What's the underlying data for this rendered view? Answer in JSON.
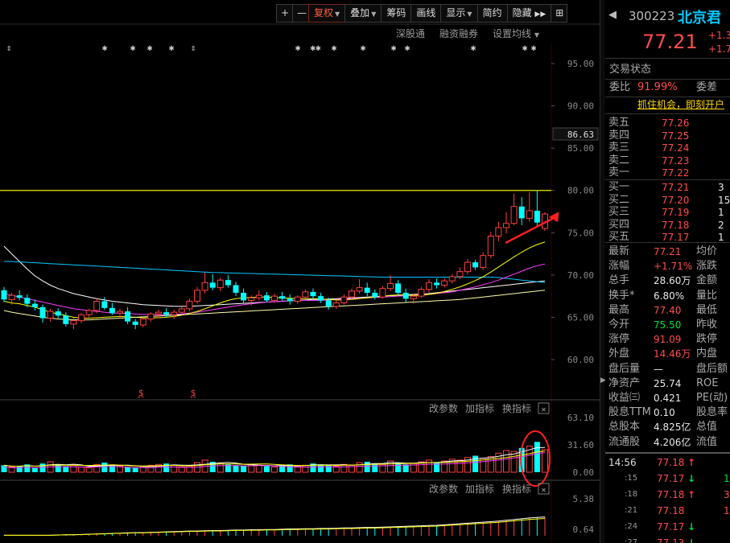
{
  "toolbar": {
    "plus": "+",
    "minus": "—",
    "rights": "复权",
    "overlay": "叠加",
    "chips": "筹码",
    "draw": "画线",
    "display": "显示",
    "simple": "简约",
    "hide": "隐藏",
    "scroll_glyph": "▶▶",
    "more_glyph": "⊞"
  },
  "subtabs": [
    "深股通",
    "融资融券",
    "设置均线"
  ],
  "chart_data": [
    {
      "type": "candlestick",
      "title": "",
      "ylim": [
        56,
        98
      ],
      "y_ticks": [
        "95.00",
        "90.00",
        "85.00",
        "80.00",
        "75.00",
        "70.00",
        "65.00",
        "60.00"
      ],
      "price_marker": "86.63",
      "resistance_line": 80.0,
      "event_markers": [
        "⇕",
        "✱",
        "✱",
        "✱",
        "✱",
        "⇕",
        "✱",
        "✱✱",
        "✱",
        "✱",
        "✱",
        "✱",
        "✱",
        "✱",
        "✱"
      ],
      "dividend_markers": [
        "$",
        "$"
      ],
      "candles": [
        [
          68.2,
          68.6,
          66.8,
          67.1
        ],
        [
          67.1,
          67.9,
          66.5,
          67.6
        ],
        [
          67.6,
          68.2,
          67.0,
          67.3
        ],
        [
          67.3,
          67.7,
          66.2,
          66.6
        ],
        [
          66.6,
          67.1,
          65.8,
          66.2
        ],
        [
          66.2,
          66.5,
          64.4,
          64.9
        ],
        [
          64.9,
          66.0,
          64.5,
          65.7
        ],
        [
          65.7,
          66.1,
          64.9,
          65.2
        ],
        [
          65.2,
          65.6,
          63.9,
          64.2
        ],
        [
          64.2,
          64.9,
          63.6,
          64.6
        ],
        [
          64.6,
          65.5,
          64.3,
          65.3
        ],
        [
          65.3,
          66.0,
          65.0,
          65.8
        ],
        [
          65.8,
          67.2,
          65.5,
          66.9
        ],
        [
          66.9,
          67.4,
          65.9,
          66.1
        ],
        [
          66.1,
          66.7,
          65.3,
          65.5
        ],
        [
          65.5,
          66.0,
          64.9,
          65.7
        ],
        [
          65.7,
          66.2,
          64.2,
          64.5
        ],
        [
          64.5,
          64.8,
          63.6,
          64.1
        ],
        [
          64.1,
          65.0,
          63.8,
          64.8
        ],
        [
          64.8,
          65.6,
          64.5,
          65.4
        ],
        [
          65.4,
          65.9,
          64.9,
          65.6
        ],
        [
          65.6,
          66.1,
          65.0,
          65.3
        ],
        [
          65.3,
          65.9,
          64.8,
          65.6
        ],
        [
          65.6,
          66.3,
          65.3,
          66.0
        ],
        [
          66.0,
          67.2,
          65.7,
          66.9
        ],
        [
          66.9,
          68.6,
          66.6,
          68.2
        ],
        [
          68.2,
          70.3,
          67.8,
          69.1
        ],
        [
          69.1,
          70.1,
          68.2,
          68.5
        ],
        [
          68.5,
          69.7,
          68.1,
          69.4
        ],
        [
          69.4,
          70.0,
          68.5,
          68.8
        ],
        [
          68.8,
          69.2,
          67.5,
          67.9
        ],
        [
          67.9,
          68.4,
          66.6,
          67.0
        ],
        [
          67.0,
          67.6,
          66.4,
          67.3
        ],
        [
          67.3,
          68.2,
          67.0,
          67.6
        ],
        [
          67.6,
          68.0,
          66.8,
          67.0
        ],
        [
          67.0,
          67.8,
          66.7,
          67.5
        ],
        [
          67.5,
          68.0,
          66.9,
          67.2
        ],
        [
          67.2,
          67.7,
          66.5,
          66.9
        ],
        [
          66.9,
          67.6,
          66.6,
          67.4
        ],
        [
          67.4,
          68.3,
          67.1,
          68.0
        ],
        [
          68.0,
          68.4,
          67.1,
          67.5
        ],
        [
          67.5,
          67.9,
          66.7,
          67.0
        ],
        [
          67.0,
          67.3,
          65.9,
          66.3
        ],
        [
          66.3,
          67.0,
          66.0,
          66.7
        ],
        [
          66.7,
          67.7,
          66.5,
          67.4
        ],
        [
          67.4,
          68.4,
          67.2,
          68.1
        ],
        [
          68.1,
          69.5,
          67.8,
          68.5
        ],
        [
          68.5,
          69.1,
          67.5,
          67.9
        ],
        [
          67.9,
          68.3,
          67.1,
          67.4
        ],
        [
          67.4,
          68.7,
          67.2,
          68.4
        ],
        [
          68.4,
          70.0,
          68.1,
          69.0
        ],
        [
          69.0,
          69.4,
          67.6,
          67.9
        ],
        [
          67.9,
          68.4,
          66.8,
          67.2
        ],
        [
          67.2,
          67.8,
          66.6,
          67.5
        ],
        [
          67.5,
          68.6,
          67.3,
          68.3
        ],
        [
          68.3,
          69.5,
          67.9,
          69.1
        ],
        [
          69.1,
          69.6,
          68.4,
          68.8
        ],
        [
          68.8,
          69.6,
          68.5,
          69.3
        ],
        [
          69.3,
          70.1,
          69.0,
          69.8
        ],
        [
          69.8,
          70.9,
          69.5,
          70.4
        ],
        [
          70.4,
          71.9,
          70.1,
          71.5
        ],
        [
          71.5,
          71.8,
          70.6,
          70.9
        ],
        [
          70.9,
          72.7,
          70.6,
          72.3
        ],
        [
          72.3,
          75.1,
          72.0,
          74.6
        ],
        [
          74.6,
          76.3,
          74.0,
          75.6
        ],
        [
          75.6,
          77.4,
          74.9,
          76.1
        ],
        [
          76.1,
          79.6,
          75.9,
          78.1
        ],
        [
          78.1,
          79.2,
          75.9,
          76.7
        ],
        [
          76.7,
          79.8,
          76.3,
          77.6
        ],
        [
          77.6,
          80.0,
          75.8,
          76.2
        ],
        [
          75.5,
          77.4,
          75.2,
          77.21
        ]
      ],
      "ma_series": [
        {
          "color": "#ffffff",
          "values": [
            73.4,
            72.5,
            71.6,
            70.7,
            69.9,
            69.3,
            68.8,
            68.4,
            68.1,
            67.8,
            67.6,
            67.4,
            67.2,
            67.05,
            66.9,
            66.8,
            66.7,
            66.6,
            66.5,
            66.45,
            66.4,
            66.35,
            66.3,
            66.3,
            66.3,
            66.35,
            66.4,
            66.45,
            66.5,
            66.55,
            66.6,
            66.65,
            66.7,
            66.75,
            66.8,
            66.85,
            66.9,
            66.95,
            67.0,
            67.05,
            67.1,
            67.1,
            67.15,
            67.2,
            67.25,
            67.3,
            67.35,
            67.4,
            67.45,
            67.5,
            67.55,
            67.6,
            67.65,
            67.7,
            67.75,
            67.8,
            67.9,
            68.0,
            68.1,
            68.2,
            68.3,
            68.4,
            68.5,
            68.6,
            68.7,
            68.8,
            68.9,
            69.0,
            69.1,
            69.2,
            69.3
          ]
        },
        {
          "color": "#00c8ff",
          "values": [
            71.6,
            71.6,
            71.55,
            71.5,
            71.45,
            71.4,
            71.35,
            71.3,
            71.25,
            71.2,
            71.15,
            71.1,
            71.05,
            71.0,
            70.95,
            70.9,
            70.85,
            70.8,
            70.75,
            70.7,
            70.65,
            70.6,
            70.55,
            70.5,
            70.45,
            70.4,
            70.35,
            70.3,
            70.28,
            70.25,
            70.22,
            70.2,
            70.18,
            70.15,
            70.12,
            70.1,
            70.08,
            70.05,
            70.02,
            70.0,
            69.98,
            69.95,
            69.92,
            69.9,
            69.88,
            69.85,
            69.82,
            69.8,
            69.78,
            69.75,
            69.75,
            69.75,
            69.75,
            69.75,
            69.75,
            69.75,
            69.75,
            69.75,
            69.75,
            69.75,
            69.75,
            69.75,
            69.75,
            69.75,
            69.7,
            69.6,
            69.5,
            69.4,
            69.3,
            69.2,
            69.1
          ]
        },
        {
          "color": "#ff3cff",
          "values": [
            67.8,
            67.6,
            67.4,
            67.2,
            67.0,
            66.8,
            66.6,
            66.4,
            66.2,
            66.0,
            65.9,
            65.8,
            65.7,
            65.6,
            65.5,
            65.5,
            65.45,
            65.4,
            65.35,
            65.3,
            65.3,
            65.3,
            65.35,
            65.4,
            65.5,
            65.6,
            65.75,
            65.9,
            66.05,
            66.2,
            66.35,
            66.5,
            66.6,
            66.7,
            66.8,
            66.85,
            66.9,
            66.95,
            67.0,
            67.0,
            67.0,
            67.0,
            67.05,
            67.1,
            67.15,
            67.2,
            67.25,
            67.3,
            67.35,
            67.4,
            67.45,
            67.5,
            67.55,
            67.6,
            67.65,
            67.7,
            67.8,
            67.9,
            68.0,
            68.2,
            68.4,
            68.6,
            68.85,
            69.1,
            69.4,
            69.75,
            70.1,
            70.45,
            70.8,
            71.1,
            71.3
          ]
        },
        {
          "color": "#ffff00",
          "values": [
            66.9,
            66.7,
            66.6,
            66.4,
            66.2,
            65.9,
            65.6,
            65.4,
            65.2,
            65.0,
            64.9,
            64.9,
            64.95,
            65.0,
            65.05,
            65.1,
            65.05,
            65.0,
            64.95,
            64.95,
            64.95,
            65.0,
            65.1,
            65.25,
            65.45,
            65.7,
            66.0,
            66.35,
            66.7,
            67.0,
            67.2,
            67.3,
            67.35,
            67.4,
            67.4,
            67.35,
            67.3,
            67.25,
            67.2,
            67.2,
            67.2,
            67.15,
            67.1,
            67.05,
            67.05,
            67.1,
            67.2,
            67.3,
            67.4,
            67.5,
            67.6,
            67.65,
            67.65,
            67.6,
            67.6,
            67.7,
            67.85,
            68.05,
            68.3,
            68.6,
            68.95,
            69.35,
            69.8,
            70.35,
            70.95,
            71.55,
            72.15,
            72.7,
            73.2,
            73.6,
            73.9
          ]
        },
        {
          "color": "#ffffaa",
          "values": [
            65.8,
            65.6,
            65.45,
            65.3,
            65.15,
            65.0,
            64.9,
            64.8,
            64.75,
            64.7,
            64.7,
            64.7,
            64.75,
            64.8,
            64.85,
            64.9,
            64.95,
            65.0,
            65.05,
            65.1,
            65.15,
            65.2,
            65.25,
            65.3,
            65.35,
            65.4,
            65.45,
            65.5,
            65.55,
            65.6,
            65.65,
            65.7,
            65.75,
            65.8,
            65.85,
            65.9,
            65.95,
            66.0,
            66.05,
            66.1,
            66.15,
            66.2,
            66.25,
            66.3,
            66.35,
            66.4,
            66.45,
            66.5,
            66.55,
            66.6,
            66.65,
            66.7,
            66.75,
            66.8,
            66.85,
            66.9,
            66.95,
            67.0,
            67.05,
            67.1,
            67.2,
            67.3,
            67.4,
            67.5,
            67.6,
            67.7,
            67.8,
            67.9,
            68.0,
            68.1,
            68.2
          ]
        }
      ]
    },
    {
      "type": "bar",
      "title": "",
      "ylim": [
        0,
        63.1
      ],
      "y_ticks": [
        "63.10",
        "31.60",
        "0.00"
      ],
      "values": [
        8,
        6,
        7,
        9,
        5,
        10,
        12,
        9,
        7,
        8,
        6,
        5,
        9,
        11,
        8,
        7,
        6,
        5,
        7,
        8,
        9,
        10,
        8,
        6,
        7,
        11,
        14,
        12,
        10,
        9,
        8,
        7,
        9,
        8,
        7,
        6,
        8,
        9,
        7,
        8,
        10,
        9,
        8,
        7,
        9,
        8,
        11,
        12,
        10,
        9,
        13,
        11,
        9,
        10,
        12,
        14,
        11,
        13,
        15,
        14,
        17,
        19,
        16,
        18,
        22,
        25,
        24,
        28,
        30,
        35,
        26
      ]
    },
    {
      "type": "bar",
      "title": "",
      "y_ticks": [
        "5.38",
        "0.64"
      ],
      "values": [
        0.1,
        0.1,
        0.1,
        0.1,
        0.1,
        0.1,
        0.1,
        0.15,
        0.2,
        0.2,
        0.25,
        0.3,
        0.35,
        0.4,
        0.45,
        0.5,
        0.55,
        0.6,
        0.6,
        0.65,
        0.7,
        0.75,
        0.8,
        0.85,
        0.9,
        0.9,
        0.95,
        1.0,
        1.0,
        1.05,
        1.1,
        1.1,
        1.15,
        1.15,
        1.2,
        1.2,
        1.25,
        1.3,
        1.3,
        1.35,
        1.35,
        1.4,
        1.4,
        1.45,
        1.5,
        1.5,
        1.55,
        1.6,
        1.6,
        1.65,
        1.7,
        1.75,
        1.8,
        1.85,
        1.9,
        1.95,
        2.0,
        2.1,
        2.2,
        2.3,
        2.4,
        2.5,
        2.6,
        2.7,
        2.8,
        2.95,
        3.1,
        3.25,
        3.4,
        3.5,
        3.6
      ]
    }
  ],
  "panels": {
    "vol_buttons": [
      "改参数",
      "加指标",
      "换指标"
    ],
    "ind_buttons": [
      "改参数",
      "加指标",
      "换指标"
    ],
    "close_glyph": "✕"
  },
  "quote": {
    "code": "300223",
    "name": "北京君",
    "price": "77.21",
    "change": "+1.3",
    "change_pct": "+1.7",
    "trading_status": "交易状态",
    "ratio_label": "委比",
    "ratio_value": "91.99%",
    "diff_label": "委差",
    "ad_text": "抓住机会，即刻开户",
    "asks": [
      {
        "label": "卖五",
        "price": "77.26"
      },
      {
        "label": "卖四",
        "price": "77.25"
      },
      {
        "label": "卖三",
        "price": "77.24"
      },
      {
        "label": "卖二",
        "price": "77.23"
      },
      {
        "label": "卖一",
        "price": "77.22"
      }
    ],
    "bids": [
      {
        "label": "买一",
        "price": "77.21",
        "vol": "3"
      },
      {
        "label": "买二",
        "price": "77.20",
        "vol": "15"
      },
      {
        "label": "买三",
        "price": "77.19",
        "vol": "1"
      },
      {
        "label": "买四",
        "price": "77.18",
        "vol": "2"
      },
      {
        "label": "买五",
        "price": "77.17",
        "vol": "1"
      }
    ],
    "stats": [
      {
        "l1": "最新",
        "v1": "77.21",
        "c1": "red",
        "l2": "均价"
      },
      {
        "l1": "涨幅",
        "v1": "+1.71%",
        "c1": "red",
        "l2": "涨跌"
      },
      {
        "l1": "总手",
        "v1": "28.60万",
        "c1": "white",
        "l2": "金额"
      },
      {
        "l1": "换手*",
        "v1": "6.80%",
        "c1": "white",
        "l2": "量比"
      },
      {
        "l1": "最高",
        "v1": "77.40",
        "c1": "red",
        "l2": "最低"
      },
      {
        "l1": "今开",
        "v1": "75.50",
        "c1": "green",
        "l2": "昨收"
      },
      {
        "l1": "涨停",
        "v1": "91.09",
        "c1": "red",
        "l2": "跌停"
      },
      {
        "l1": "外盘",
        "v1": "14.46万",
        "c1": "red",
        "l2": "内盘"
      },
      {
        "l1": "盘后量",
        "v1": "—",
        "c1": "white",
        "l2": "盘后额"
      },
      {
        "l1": "净资产",
        "v1": "25.74",
        "c1": "white",
        "l2": "ROE"
      },
      {
        "l1": "收益㈢",
        "v1": "0.421",
        "c1": "white",
        "l2": "PE(动)"
      },
      {
        "l1": "股息TTM",
        "v1": "0.10",
        "c1": "white",
        "l2": "股息率"
      },
      {
        "l1": "总股本",
        "v1": "4.825亿",
        "c1": "white",
        "l2": "总值"
      },
      {
        "l1": "流通股",
        "v1": "4.206亿",
        "c1": "white",
        "l2": "流值"
      }
    ],
    "ticks": [
      {
        "time": "14:56",
        "price": "77.18",
        "dir": "up",
        "vol": ""
      },
      {
        "time": ":15",
        "price": "77.17",
        "dir": "down",
        "vol": "1"
      },
      {
        "time": ":18",
        "price": "77.18",
        "dir": "up",
        "vol": "3"
      },
      {
        "time": ":21",
        "price": "77.18",
        "dir": "",
        "vol": "1"
      },
      {
        "time": ":24",
        "price": "77.17",
        "dir": "down",
        "vol": ""
      },
      {
        "time": ":27",
        "price": "77.13",
        "dir": "down",
        "vol": ""
      }
    ],
    "colors": {
      "up": "#ff4d4d",
      "down": "#00e13c",
      "accent": "#00c8ff"
    }
  }
}
